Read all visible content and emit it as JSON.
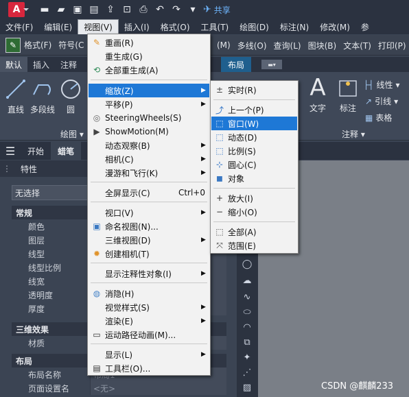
{
  "app": {
    "logo_letter": "A"
  },
  "quick_access": {
    "share_label": "共享"
  },
  "menubar": {
    "items": [
      "文件(F)",
      "编辑(E)",
      "视图(V)",
      "插入(I)",
      "格式(O)",
      "工具(T)",
      "绘图(D)",
      "标注(N)",
      "修改(M)",
      "参"
    ],
    "active": "视图(V)"
  },
  "toolbar2": {
    "left_items": [
      "格式(F)",
      "符号(C"
    ],
    "right_items": [
      "(M)",
      "多线(O)",
      "查询(L)",
      "图块(B)",
      "文本(T)",
      "打印(P)",
      "图"
    ]
  },
  "ribbon_tabs": {
    "items": [
      "默认",
      "插入",
      "注释"
    ],
    "selected": "默认",
    "layout": "布局"
  },
  "ribbon": {
    "line": "直线",
    "polyline": "多段线",
    "circle": "圆",
    "draw_panel": "绘图",
    "text": "文字",
    "dimension": "标注",
    "linear": "线性",
    "leader": "引线",
    "table": "表格",
    "annotation_panel": "注释"
  },
  "file_tabs": {
    "start": "开始",
    "current": "蜡笔"
  },
  "properties": {
    "title": "特性",
    "selection": "无选择",
    "sections": {
      "general": "常规",
      "3d": "三维效果",
      "layout": "布局"
    },
    "general_rows": [
      "颜色",
      "图层",
      "线型",
      "线型比例",
      "线宽",
      "透明度",
      "厚度"
    ],
    "3d_rows": [
      "材质"
    ],
    "layout_rows": [
      {
        "k": "布局名称",
        "v": "布局1"
      },
      {
        "k": "页面设置名",
        "v": "<无>"
      }
    ]
  },
  "view_menu": {
    "items": {
      "redraw": "重画(R)",
      "regen": "重生成(G)",
      "regen_all": "全部重生成(A)",
      "zoom": "缩放(Z)",
      "pan": "平移(P)",
      "steering": "SteeringWheels(S)",
      "showmotion": "ShowMotion(M)",
      "orbit": "动态观察(B)",
      "camera": "相机(C)",
      "walk": "漫游和飞行(K)",
      "fullscreen": "全屏显示(C)",
      "fullscreen_shortcut": "Ctrl+0",
      "viewports": "视口(V)",
      "named_views": "命名视图(N)...",
      "3d_views": "三维视图(D)",
      "create_camera": "创建相机(T)",
      "annotation_objects": "显示注释性对象(I)",
      "hide": "消隐(H)",
      "visual_styles": "视觉样式(S)",
      "render": "渲染(E)",
      "motion_path": "运动路径动画(M)...",
      "display": "显示(L)",
      "toolbars": "工具栏(O)..."
    }
  },
  "zoom_menu": {
    "items": {
      "realtime": "实时(R)",
      "previous": "上一个(P)",
      "window": "窗口(W)",
      "dynamic": "动态(D)",
      "scale": "比例(S)",
      "center": "圆心(C)",
      "object": "对象",
      "in": "放大(I)",
      "out": "缩小(O)",
      "all": "全部(A)",
      "extents": "范围(E)"
    }
  },
  "watermark": "CSDN @麒麟233",
  "colors": {
    "highlight": "#1e78d6",
    "menu_bg": "#f2f2f2",
    "ui_dark": "#2b3240"
  }
}
